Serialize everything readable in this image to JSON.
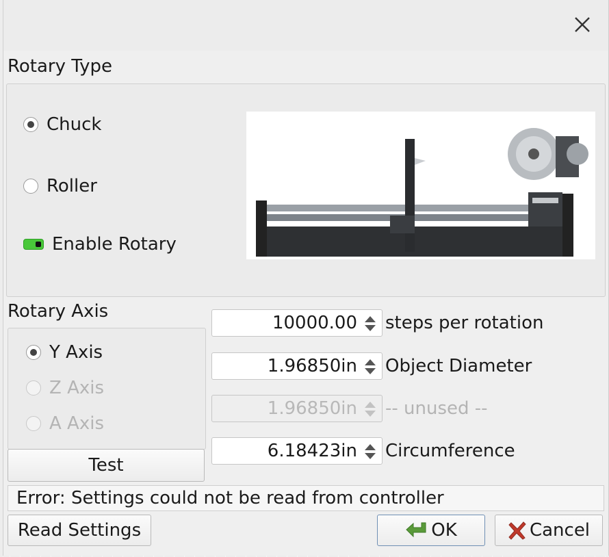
{
  "dialog": {
    "close_icon": "close-icon"
  },
  "rotary_type": {
    "label": "Rotary Type",
    "options": [
      {
        "label": "Chuck",
        "selected": true
      },
      {
        "label": "Roller",
        "selected": false
      }
    ],
    "enable_rotary_label": "Enable Rotary",
    "enable_rotary_on": true
  },
  "rotary_axis": {
    "label": "Rotary Axis",
    "options": [
      {
        "label": "Y Axis",
        "selected": true,
        "enabled": true
      },
      {
        "label": "Z Axis",
        "selected": false,
        "enabled": false
      },
      {
        "label": "A Axis",
        "selected": false,
        "enabled": false
      }
    ],
    "test_label": "Test"
  },
  "fields": [
    {
      "value": "10000.00",
      "label": "steps per rotation",
      "enabled": true
    },
    {
      "value": "1.96850in",
      "label": "Object Diameter",
      "enabled": true
    },
    {
      "value": "1.96850in",
      "label": "-- unused --",
      "enabled": false
    },
    {
      "value": "6.18423in",
      "label": "Circumference",
      "enabled": true
    }
  ],
  "status": {
    "text": "Error: Settings could not be read from controller"
  },
  "buttons": {
    "read_settings": "Read Settings",
    "ok": "OK",
    "cancel": "Cancel"
  },
  "colors": {
    "toggle_on": "#49c83a",
    "ok_icon": "#5a9a3a",
    "cancel_icon": "#c0392b"
  }
}
